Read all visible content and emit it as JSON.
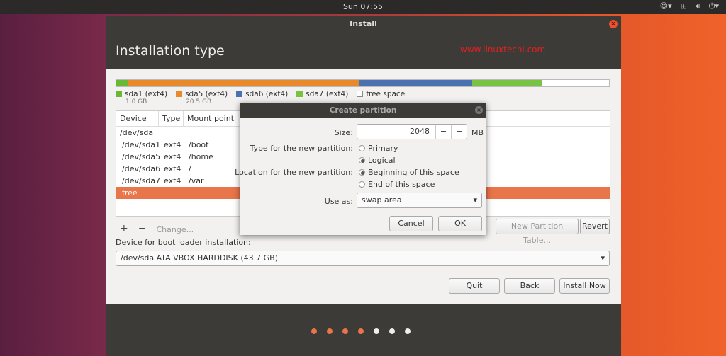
{
  "topbar": {
    "clock": "Sun 07:55",
    "icons": [
      "accessibility-icon",
      "network-icon",
      "volume-icon",
      "power-icon"
    ]
  },
  "window": {
    "title": "Install",
    "heading": "Installation type",
    "watermark": "www.linuxtechi.com"
  },
  "partitions": [
    {
      "name": "sda1 (ext4)",
      "size": "1.0 GB",
      "color": "#6ab934",
      "fraction": 0.024
    },
    {
      "name": "sda5 (ext4)",
      "size": "20.5 GB",
      "color": "#e98a2a",
      "fraction": 0.469
    },
    {
      "name": "sda6 (ext4)",
      "size": "",
      "color": "#4a72b0",
      "fraction": 0.23
    },
    {
      "name": "sda7 (ext4)",
      "size": "",
      "color": "#78c442",
      "fraction": 0.14
    },
    {
      "name": "free space",
      "size": "",
      "color": "#ffffff",
      "fraction": 0.137
    }
  ],
  "table": {
    "headers": [
      "Device",
      "Type",
      "Mount point"
    ],
    "rows": [
      [
        "/dev/sda",
        "",
        ""
      ],
      [
        "/dev/sda1",
        "ext4",
        "/boot"
      ],
      [
        "/dev/sda5",
        "ext4",
        "/home"
      ],
      [
        "/dev/sda6",
        "ext4",
        "/"
      ],
      [
        "/dev/sda7",
        "ext4",
        "/var"
      ],
      [
        "free space",
        "",
        ""
      ]
    ]
  },
  "tools": {
    "add": "+",
    "remove": "−",
    "change": "Change...",
    "new_table": "New Partition Table...",
    "revert": "Revert"
  },
  "boot": {
    "label": "Device for boot loader installation:",
    "value": "/dev/sda   ATA VBOX HARDDISK (43.7 GB)"
  },
  "buttons": {
    "quit": "Quit",
    "back": "Back",
    "install": "Install Now"
  },
  "progress_dots": {
    "total": 7,
    "completed": 4,
    "active_color": "#e9754a",
    "inactive_color": "#eeeeee"
  },
  "dialog": {
    "title": "Create partition",
    "size_label": "Size:",
    "size_value": "2048",
    "unit": "MB",
    "type_label": "Type for the new partition:",
    "type_options": [
      "Primary",
      "Logical"
    ],
    "type_selected": "Logical",
    "loc_label": "Location for the new partition:",
    "loc_options": [
      "Beginning of this space",
      "End of this space"
    ],
    "loc_selected": "Beginning of this space",
    "use_label": "Use as:",
    "use_value": "swap area",
    "cancel": "Cancel",
    "ok": "OK"
  }
}
